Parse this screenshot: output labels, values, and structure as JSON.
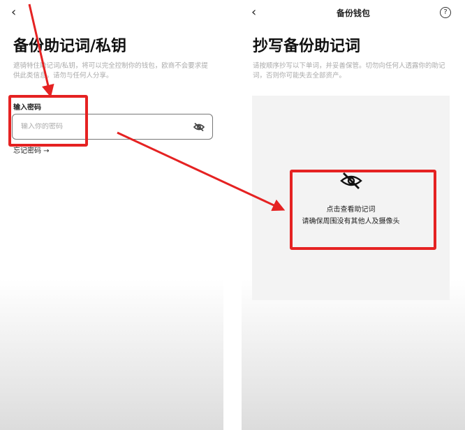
{
  "left": {
    "back": "‹",
    "title": "备份助记词/私钥",
    "description": "遮骑特住助记词/私钥，将可以完全控制你的钱包，欧商不会要求提供此类信息。请勿与任何人分享。",
    "password_label": "输入密码",
    "password_placeholder": "输入你的密码",
    "forgot_password": "忘记密码 →"
  },
  "right": {
    "back": "‹",
    "header_title": "备份钱包",
    "help": "?",
    "title": "抄写备份助记词",
    "description": "请按顺序抄写以下单词，并妥善保管。切勿向任何人透露你的助记词，否则你可能失去全部资产。",
    "reveal_line1": "点击查看助记词",
    "reveal_line2": "请确保周围没有其他人及摄像头"
  },
  "colors": {
    "annotation_red": "#e52222",
    "reveal_bg": "#f3f3f3"
  },
  "icons": [
    "back-icon",
    "eye-off-icon",
    "help-icon"
  ]
}
